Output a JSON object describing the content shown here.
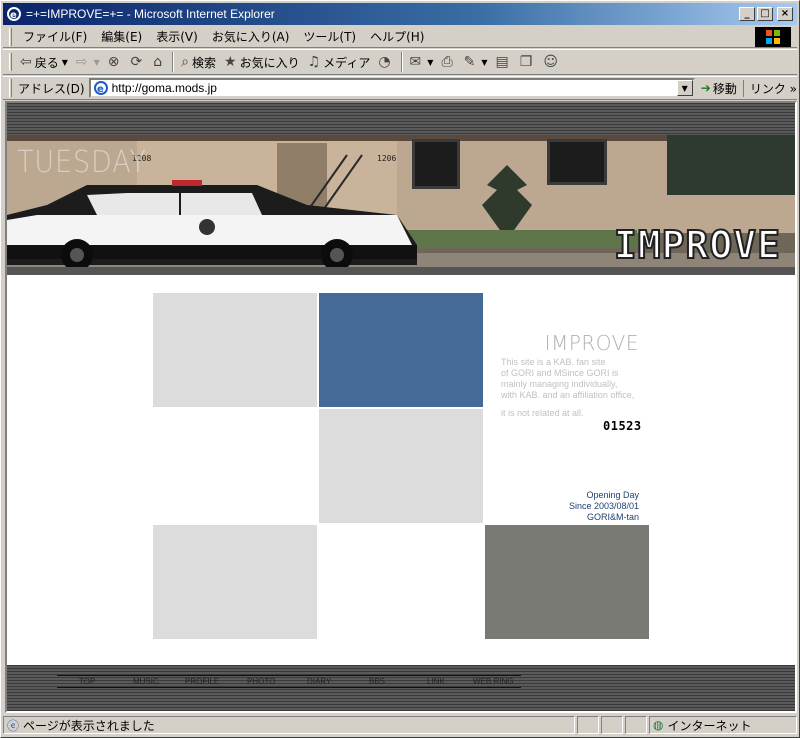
{
  "window": {
    "title": "=+=IMPROVE=+= - Microsoft Internet Explorer",
    "minimize": "_",
    "maximize": "□",
    "close": "×"
  },
  "menubar": {
    "items": [
      "ファイル(F)",
      "編集(E)",
      "表示(V)",
      "お気に入り(A)",
      "ツール(T)",
      "ヘルプ(H)"
    ]
  },
  "toolbar": {
    "back_label": "戻る",
    "search_label": "検索",
    "favorites_label": "お気に入り",
    "media_label": "メディア"
  },
  "addressbar": {
    "label": "アドレス(D)",
    "url": "http://goma.mods.jp",
    "go_label": "移動",
    "links_label": "リンク »"
  },
  "page": {
    "banner_day": "TUESDAY",
    "banner_logo": "IMPROVE",
    "site_title": "IMPROVE",
    "description_lines": [
      "This site is a KAB. fan site",
      "of GORI and MSince GORI is",
      "mainly managing individually,",
      "with KAB. and an affiliation office,"
    ],
    "description_last": "it is not related at all.",
    "counter": "01523",
    "opening": [
      "Opening Day",
      "Since 2003/08/01",
      "GORI&M-tan"
    ],
    "nav": [
      "TOP",
      "MUSIC",
      "PROFILE",
      "PHOTO",
      "DIARY",
      "BBS",
      "LINK",
      "WEB RING"
    ]
  },
  "colors": {
    "tile_light": "#dcdcdc",
    "tile_blue": "#456a97",
    "tile_dark": "#7a7a74"
  },
  "statusbar": {
    "text": "ページが表示されました",
    "zone": "インターネット"
  }
}
